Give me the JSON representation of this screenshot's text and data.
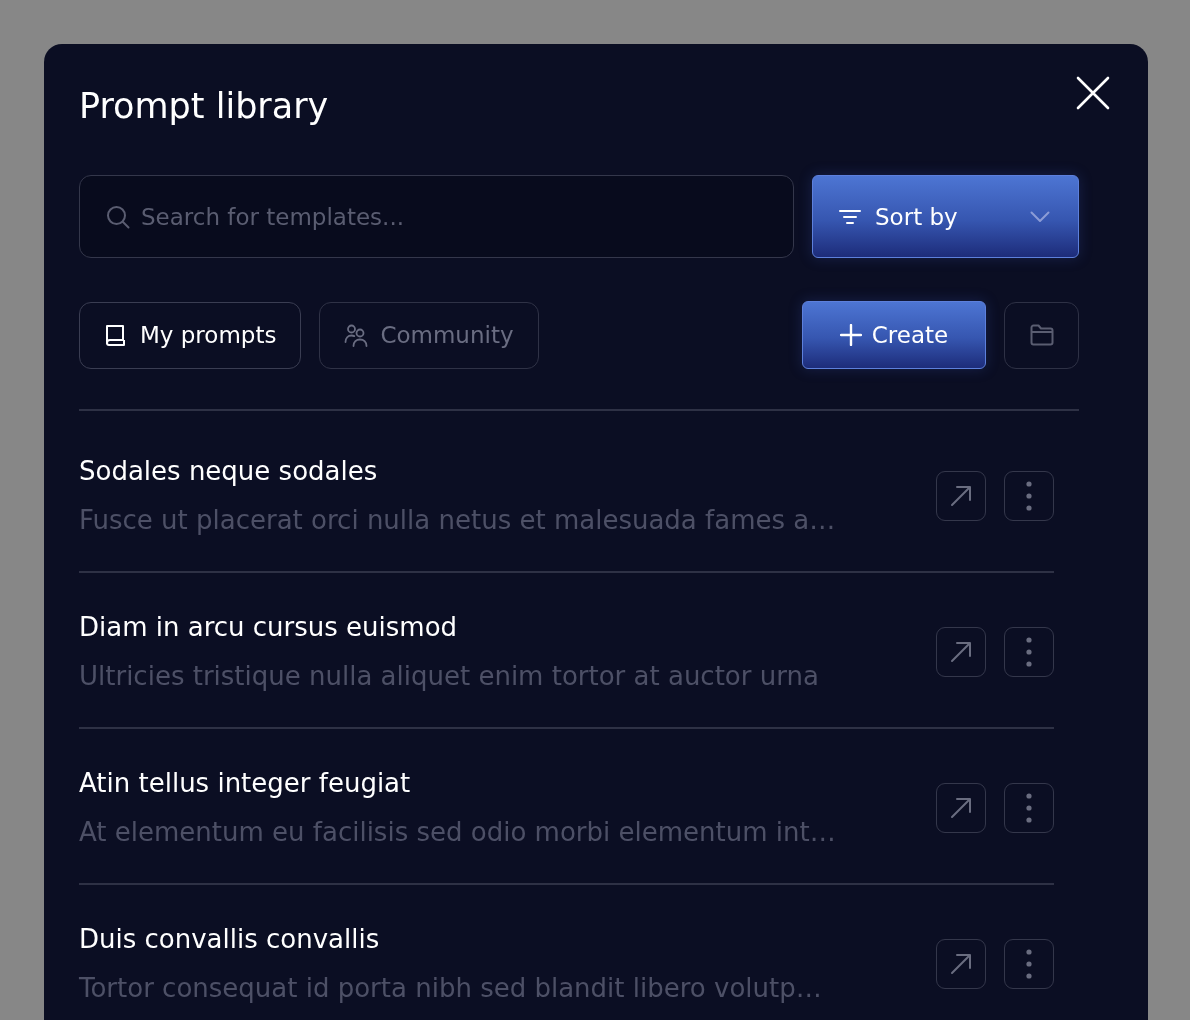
{
  "dialog": {
    "title": "Prompt library"
  },
  "search": {
    "placeholder": "Search for templates..."
  },
  "sort": {
    "label": "Sort by"
  },
  "tabs": [
    {
      "label": "My prompts",
      "selected": true
    },
    {
      "label": "Community",
      "selected": false
    }
  ],
  "create": {
    "label": "Create"
  },
  "prompts": [
    {
      "title": "Sodales neque sodales",
      "description": "Fusce ut placerat orci nulla netus et malesuada fames a…"
    },
    {
      "title": "Diam in arcu cursus euismod",
      "description": "Ultricies tristique nulla aliquet enim tortor at auctor urna"
    },
    {
      "title": "Atin tellus integer feugiat",
      "description": "At elementum eu facilisis sed odio morbi elementum int…"
    },
    {
      "title": "Duis convallis convallis",
      "description": "Tortor consequat id porta nibh sed blandit libero volutp…"
    }
  ]
}
